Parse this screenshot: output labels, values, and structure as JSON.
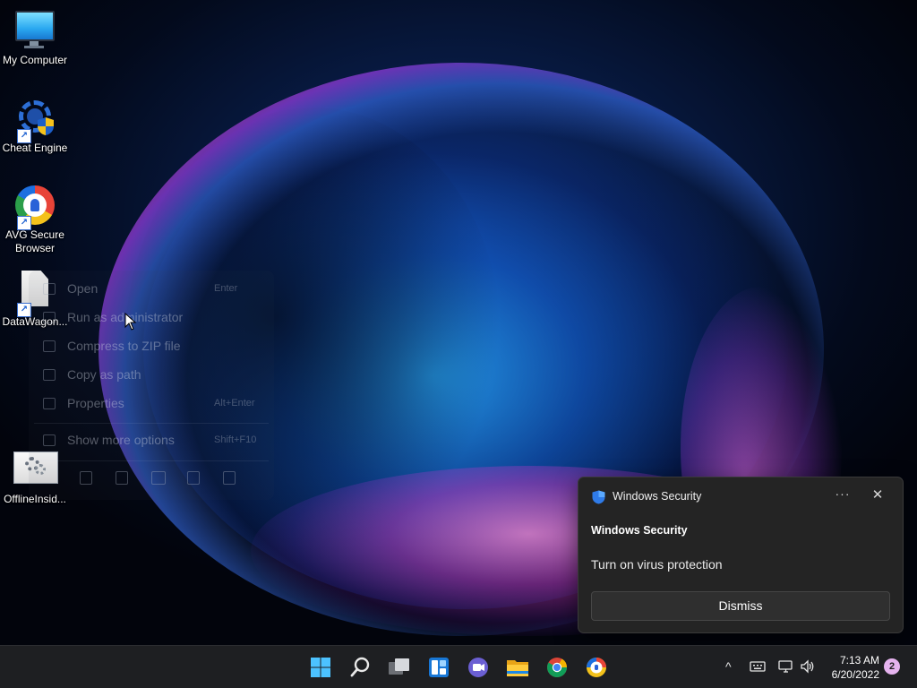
{
  "desktop": {
    "icons": [
      {
        "label": "My Computer",
        "icon": "monitor-icon"
      },
      {
        "label": "Cheat Engine",
        "icon": "cheat-engine-icon"
      },
      {
        "label": "AVG Secure Browser",
        "icon": "avg-browser-icon"
      },
      {
        "label": "DataWagon...",
        "icon": "document-icon"
      },
      {
        "label": "OfflineInsid...",
        "icon": "settings-file-icon"
      }
    ]
  },
  "context_menu": {
    "items": [
      {
        "label": "Open",
        "shortcut": "Enter"
      },
      {
        "label": "Run as administrator",
        "shortcut": ""
      },
      {
        "label": "Compress to ZIP file",
        "shortcut": ""
      },
      {
        "label": "Copy as path",
        "shortcut": ""
      },
      {
        "label": "Properties",
        "shortcut": "Alt+Enter"
      },
      {
        "label": "Show more options",
        "shortcut": "Shift+F10"
      }
    ],
    "bottom_actions": [
      "copy-icon",
      "paste-icon",
      "rename-icon",
      "share-icon",
      "delete-icon"
    ]
  },
  "notification": {
    "app_name": "Windows Security",
    "title": "Windows Security",
    "body": "Turn on virus protection",
    "more_label": "···",
    "close_label": "✕",
    "dismiss_label": "Dismiss"
  },
  "taskbar": {
    "apps": [
      "start-icon",
      "search-icon",
      "task-view-icon",
      "widgets-icon",
      "teams-chat-icon",
      "file-explorer-icon",
      "chrome-icon",
      "avg-browser-icon"
    ],
    "tray": {
      "chevron": "^",
      "time": "7:13 AM",
      "date": "6/20/2022",
      "notification_count": "2"
    }
  },
  "colors": {
    "accent": "#4cc2ff",
    "taskbar_bg": "#1e1f22",
    "toast_bg": "#242424",
    "badge": "#e5b3ef"
  }
}
